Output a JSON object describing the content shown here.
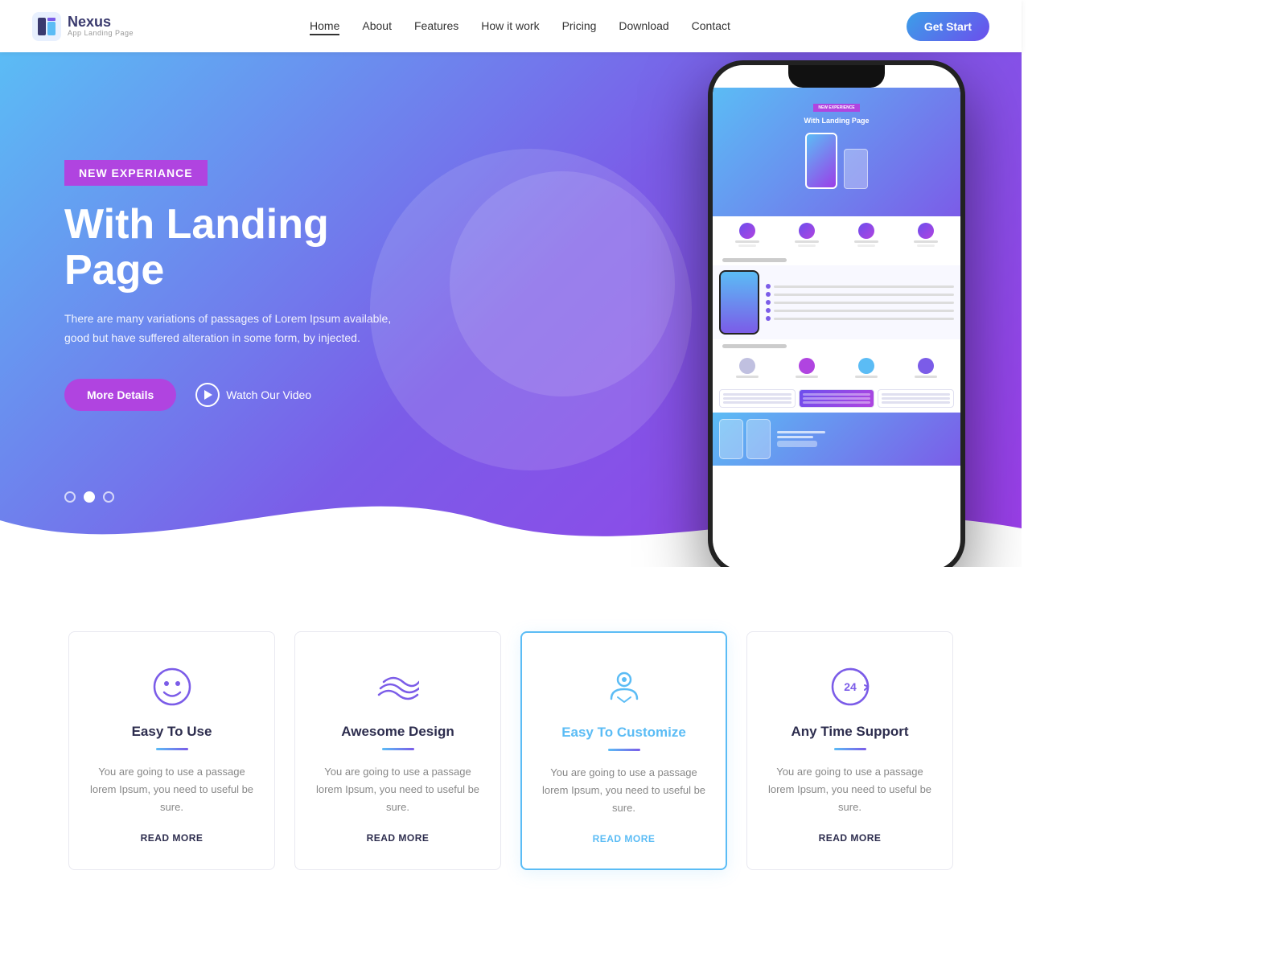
{
  "brand": {
    "name": "Nexus",
    "sub": "App Landing Page",
    "logo_icon_color": "#3a3a6e"
  },
  "nav": {
    "links": [
      {
        "label": "Home",
        "active": true
      },
      {
        "label": "About",
        "active": false
      },
      {
        "label": "Features",
        "active": false
      },
      {
        "label": "How it work",
        "active": false
      },
      {
        "label": "Pricing",
        "active": false
      },
      {
        "label": "Download",
        "active": false
      },
      {
        "label": "Contact",
        "active": false
      }
    ],
    "cta_label": "Get Start"
  },
  "hero": {
    "badge": "NEW EXPERIANCE",
    "title": "With Landing Page",
    "desc": "There are many variations of passages of Lorem Ipsum available, good but have suffered alteration in some form, by injected.",
    "btn_details": "More Details",
    "btn_video": "Watch Our Video",
    "dots": [
      {
        "active": false
      },
      {
        "active": true
      },
      {
        "active": false
      }
    ]
  },
  "features": [
    {
      "id": "easy-to-use",
      "title": "Easy To Use",
      "desc": "You are going to use a passage lorem Ipsum, you need to useful be sure.",
      "read_more": "READ MORE",
      "icon_type": "smiley",
      "highlighted": false,
      "accent_color": "#7b5ce8"
    },
    {
      "id": "awesome-design",
      "title": "Awesome Design",
      "desc": "You are going to use a passage lorem Ipsum, you need to useful be sure.",
      "read_more": "READ MORE",
      "icon_type": "waves",
      "highlighted": false,
      "accent_color": "#7b5ce8"
    },
    {
      "id": "easy-to-customize",
      "title": "Easy To Customize",
      "desc": "You are going to use a passage lorem Ipsum, you need to useful be sure.",
      "read_more": "READ MORE",
      "icon_type": "customize",
      "highlighted": true,
      "accent_color": "#5bbcf5"
    },
    {
      "id": "any-time-support",
      "title": "Any Time Support",
      "desc": "You are going to use a passage lorem Ipsum, you need to useful be sure.",
      "read_more": "READ MORE",
      "icon_type": "24h",
      "highlighted": false,
      "accent_color": "#7b5ce8"
    }
  ]
}
